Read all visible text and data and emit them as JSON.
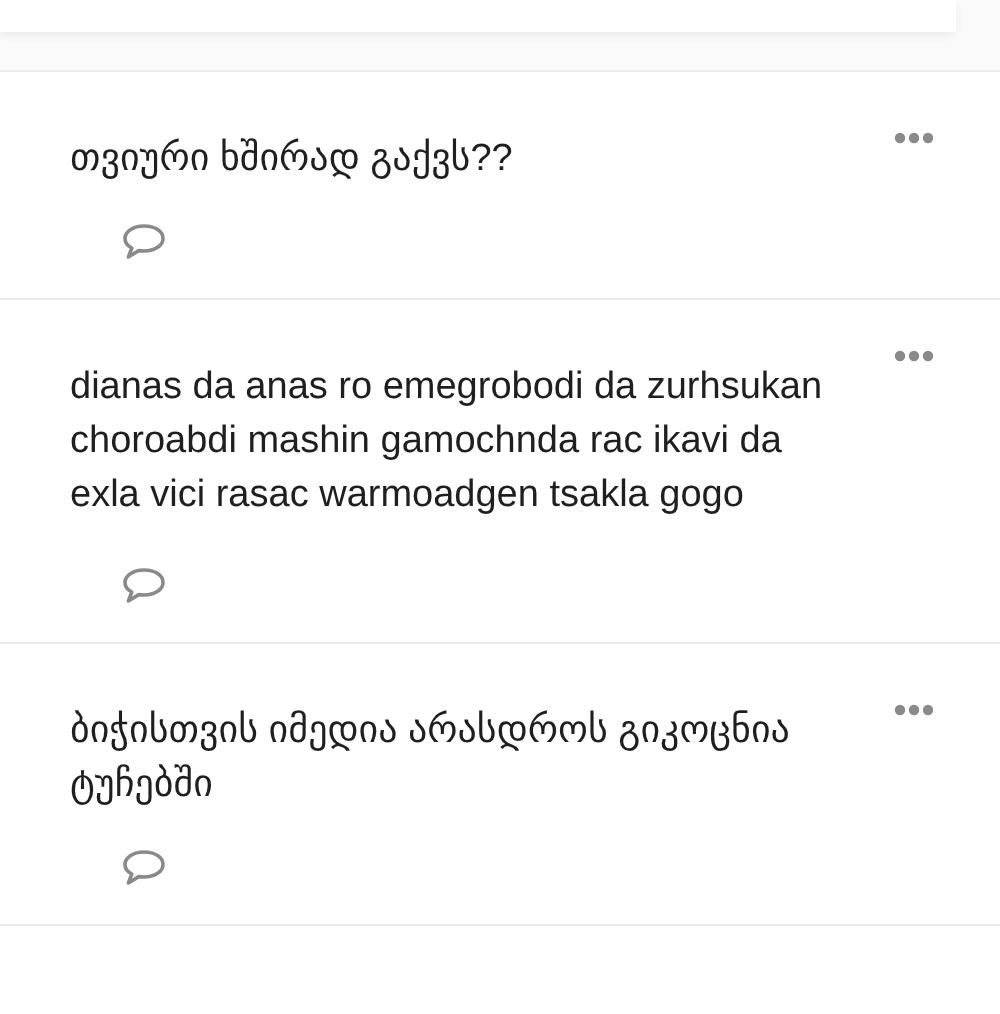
{
  "posts": [
    {
      "text": "თვიური ხშირად გაქვს??"
    },
    {
      "text": "dianas da anas ro emegrobodi da zurhsukan choroabdi mashin gamochnda rac ikavi da exla vici rasac warmoadgen tsakla gogo"
    },
    {
      "text": "ბიჭისთვის იმედია არასდროს გიკოცნია ტუჩებში"
    }
  ]
}
